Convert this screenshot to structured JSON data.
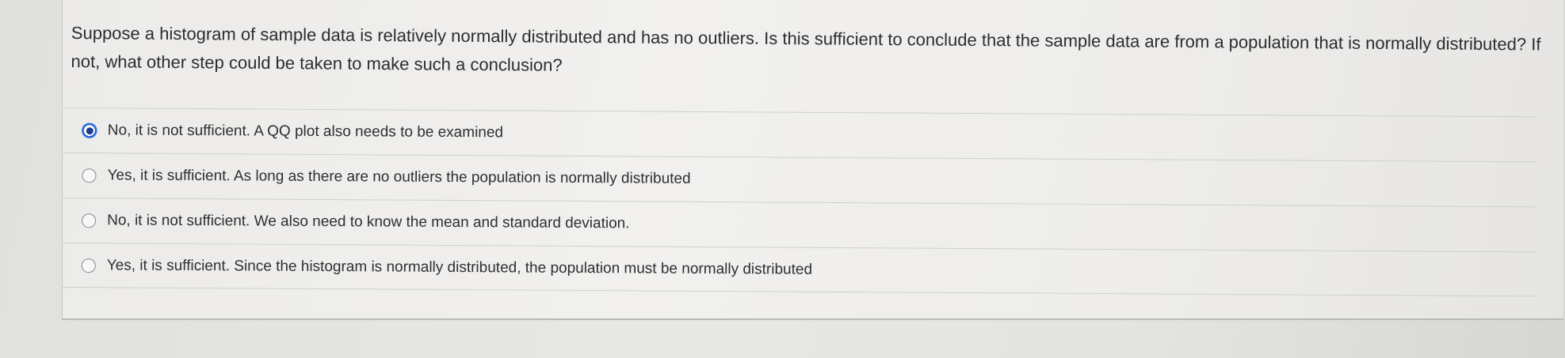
{
  "question": {
    "text": "Suppose a histogram of sample data is relatively normally distributed and has no outliers.  Is this sufficient to conclude that the sample data are from a population that is normally distributed?  If not, what other step could be taken to make such a conclusion?"
  },
  "options": [
    {
      "label": "No, it is not sufficient. A QQ plot also needs to be examined",
      "selected": true
    },
    {
      "label": "Yes, it is sufficient. As long as there are no outliers the population is normally distributed",
      "selected": false
    },
    {
      "label": "No, it is not sufficient. We also need to know the mean and standard deviation.",
      "selected": false
    },
    {
      "label": "Yes, it is sufficient. Since the histogram is normally distributed, the population must be normally distributed",
      "selected": false
    }
  ],
  "colors": {
    "selected_radio": "#1f63d6",
    "text": "#2d2d2d"
  }
}
